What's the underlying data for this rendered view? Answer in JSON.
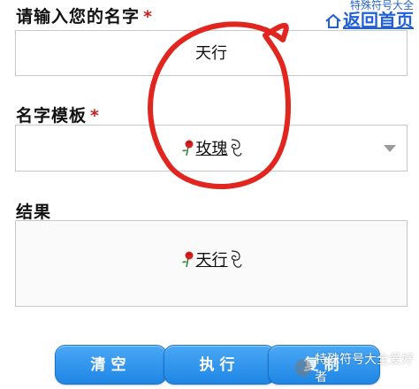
{
  "form": {
    "name_label": "请输入您的名字",
    "required_mark": "*",
    "name_value": "天行",
    "template_label": "名字模板",
    "template_value": "玫瑰",
    "result_label": "结果",
    "result_value": "天行"
  },
  "header": {
    "small_link": "特殊符号大全",
    "home_link": "返回首页"
  },
  "buttons": {
    "clear": "清空",
    "execute": "执行",
    "copy": "复制"
  },
  "watermark": {
    "text": "特殊符号大全爱好者"
  },
  "colors": {
    "button": "#2a8fe9",
    "required": "#cc1f1f",
    "link": "#1f5fd8",
    "annotation": "#e0261e"
  },
  "icons": [
    "home-icon",
    "rose-icon",
    "swirl-icon",
    "caret-down-icon",
    "wechat-icon"
  ]
}
